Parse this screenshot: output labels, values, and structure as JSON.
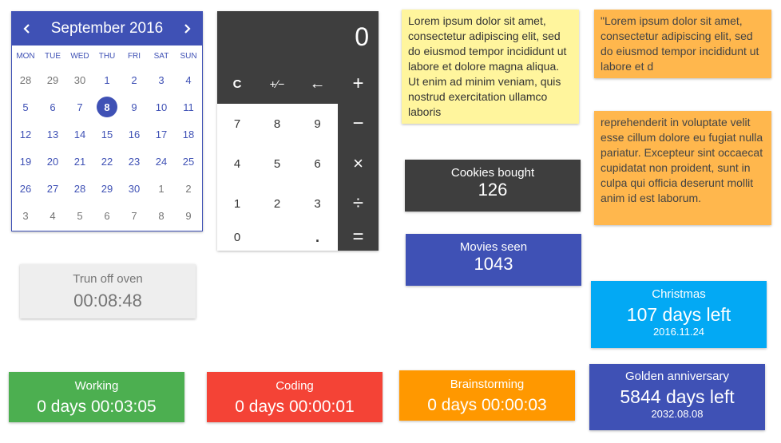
{
  "calendar": {
    "title": "September 2016",
    "weekdays": [
      "MON",
      "TUE",
      "WED",
      "THU",
      "FRI",
      "SAT",
      "SUN"
    ],
    "days": [
      {
        "d": "28",
        "m": true
      },
      {
        "d": "29",
        "m": true
      },
      {
        "d": "30",
        "m": true
      },
      {
        "d": "1"
      },
      {
        "d": "2"
      },
      {
        "d": "3"
      },
      {
        "d": "4"
      },
      {
        "d": "5"
      },
      {
        "d": "6"
      },
      {
        "d": "7"
      },
      {
        "d": "8",
        "today": true
      },
      {
        "d": "9"
      },
      {
        "d": "10"
      },
      {
        "d": "11"
      },
      {
        "d": "12"
      },
      {
        "d": "13"
      },
      {
        "d": "14"
      },
      {
        "d": "15"
      },
      {
        "d": "16"
      },
      {
        "d": "17"
      },
      {
        "d": "18"
      },
      {
        "d": "19"
      },
      {
        "d": "20"
      },
      {
        "d": "21"
      },
      {
        "d": "22"
      },
      {
        "d": "23"
      },
      {
        "d": "24"
      },
      {
        "d": "25"
      },
      {
        "d": "26"
      },
      {
        "d": "27"
      },
      {
        "d": "28"
      },
      {
        "d": "29"
      },
      {
        "d": "30"
      },
      {
        "d": "1",
        "m": true
      },
      {
        "d": "2",
        "m": true
      },
      {
        "d": "3",
        "m": true
      },
      {
        "d": "4",
        "m": true
      },
      {
        "d": "5",
        "m": true
      },
      {
        "d": "6",
        "m": true
      },
      {
        "d": "7",
        "m": true
      },
      {
        "d": "8",
        "m": true
      },
      {
        "d": "9",
        "m": true
      }
    ]
  },
  "calculator": {
    "display": "0",
    "keys": {
      "clear": "C",
      "sign": "+⁄−",
      "back": "←",
      "plus": "+",
      "minus": "−",
      "times": "×",
      "divide": "÷",
      "equals": "=",
      "n7": "7",
      "n8": "8",
      "n9": "9",
      "n4": "4",
      "n5": "5",
      "n6": "6",
      "n1": "1",
      "n2": "2",
      "n3": "3",
      "n0": "0",
      "dot": "."
    }
  },
  "notes": {
    "yellow": "Lorem ipsum dolor sit amet, consectetur adipiscing elit, sed do eiusmod tempor incididunt ut labore et dolore magna aliqua. Ut enim ad minim veniam, quis nostrud exercitation ullamco laboris",
    "orange1": "\"Lorem ipsum dolor sit amet, consectetur adipiscing elit, sed do eiusmod tempor incididunt ut labore et d",
    "orange2": "reprehenderit in voluptate velit esse cillum dolore eu fugiat nulla pariatur. Excepteur sint occaecat cupidatat non proident, sunt in culpa qui officia deserunt mollit anim id est laborum."
  },
  "counters": {
    "cookies": {
      "label": "Cookies bought",
      "value": "126"
    },
    "movies": {
      "label": "Movies seen",
      "value": "1043"
    }
  },
  "timer": {
    "label": "Trun off oven",
    "value": "00:08:48"
  },
  "countdowns": {
    "christmas": {
      "label": "Christmas",
      "value": "107 days left",
      "date": "2016.11.24"
    },
    "golden": {
      "label": "Golden anniversary",
      "value": "5844 days left",
      "date": "2032.08.08"
    }
  },
  "stopwatches": {
    "working": {
      "label": "Working",
      "value": "0 days 00:03:05"
    },
    "coding": {
      "label": "Coding",
      "value": "0 days 00:00:01"
    },
    "brainstorming": {
      "label": "Brainstorming",
      "value": "0 days 00:00:03"
    }
  },
  "colors": {
    "indigo": "#3f51b5",
    "dark": "#3e3e3e",
    "yellow_note": "#fff59d",
    "orange_note": "#ffb74d",
    "light_blue": "#03a9f4",
    "green": "#4caf50",
    "red": "#f44336",
    "orange": "#ff9800"
  }
}
